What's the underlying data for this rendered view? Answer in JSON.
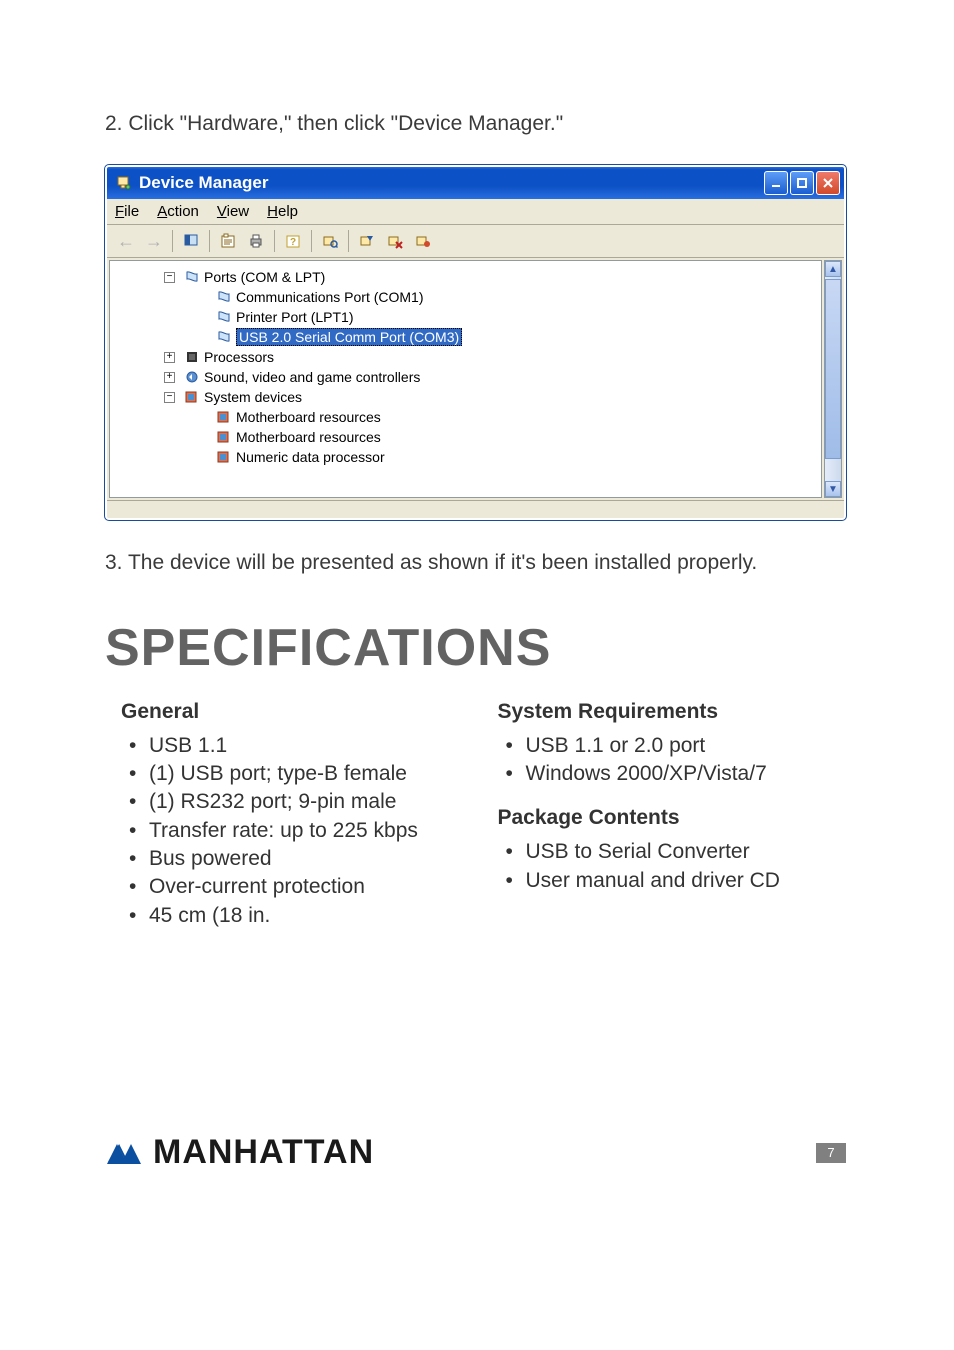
{
  "instruction_2": "2. Click \"Hardware,\" then click \"Device Manager.\"",
  "window": {
    "title": "Device Manager",
    "menus": {
      "file": "File",
      "action": "Action",
      "view": "View",
      "help": "Help"
    },
    "tree": {
      "ports": {
        "label": "Ports (COM & LPT)",
        "children": {
          "com1": "Communications Port (COM1)",
          "lpt1": "Printer Port (LPT1)",
          "usbserial": "USB 2.0 Serial Comm Port (COM3)"
        }
      },
      "processors": "Processors",
      "sound": "Sound, video and game controllers",
      "system": {
        "label": "System devices",
        "children": {
          "mb1": "Motherboard resources",
          "mb2": "Motherboard resources",
          "ndp": "Numeric data processor"
        }
      }
    }
  },
  "instruction_3": "3.  The device will be presented as shown if it's been installed properly.",
  "heading_specs": "specifications",
  "general": {
    "title": "General",
    "items": {
      "i0": "USB 1.1",
      "i1": "(1) USB port; type-B female",
      "i2": "(1) RS232 port; 9-pin male",
      "i3": "Transfer rate: up to 225 kbps",
      "i4": "Bus powered",
      "i5": "Over-current protection",
      "i6": "45 cm (18 in."
    }
  },
  "sysreq": {
    "title": "System Requirements",
    "items": {
      "i0": "USB 1.1 or 2.0 port",
      "i1": "Windows 2000/XP/Vista/7"
    }
  },
  "pkg": {
    "title": "Package Contents",
    "items": {
      "i0": "USB to Serial Converter",
      "i1": "User manual and driver CD"
    }
  },
  "brand": "MANHATTAN",
  "page_number": "7"
}
